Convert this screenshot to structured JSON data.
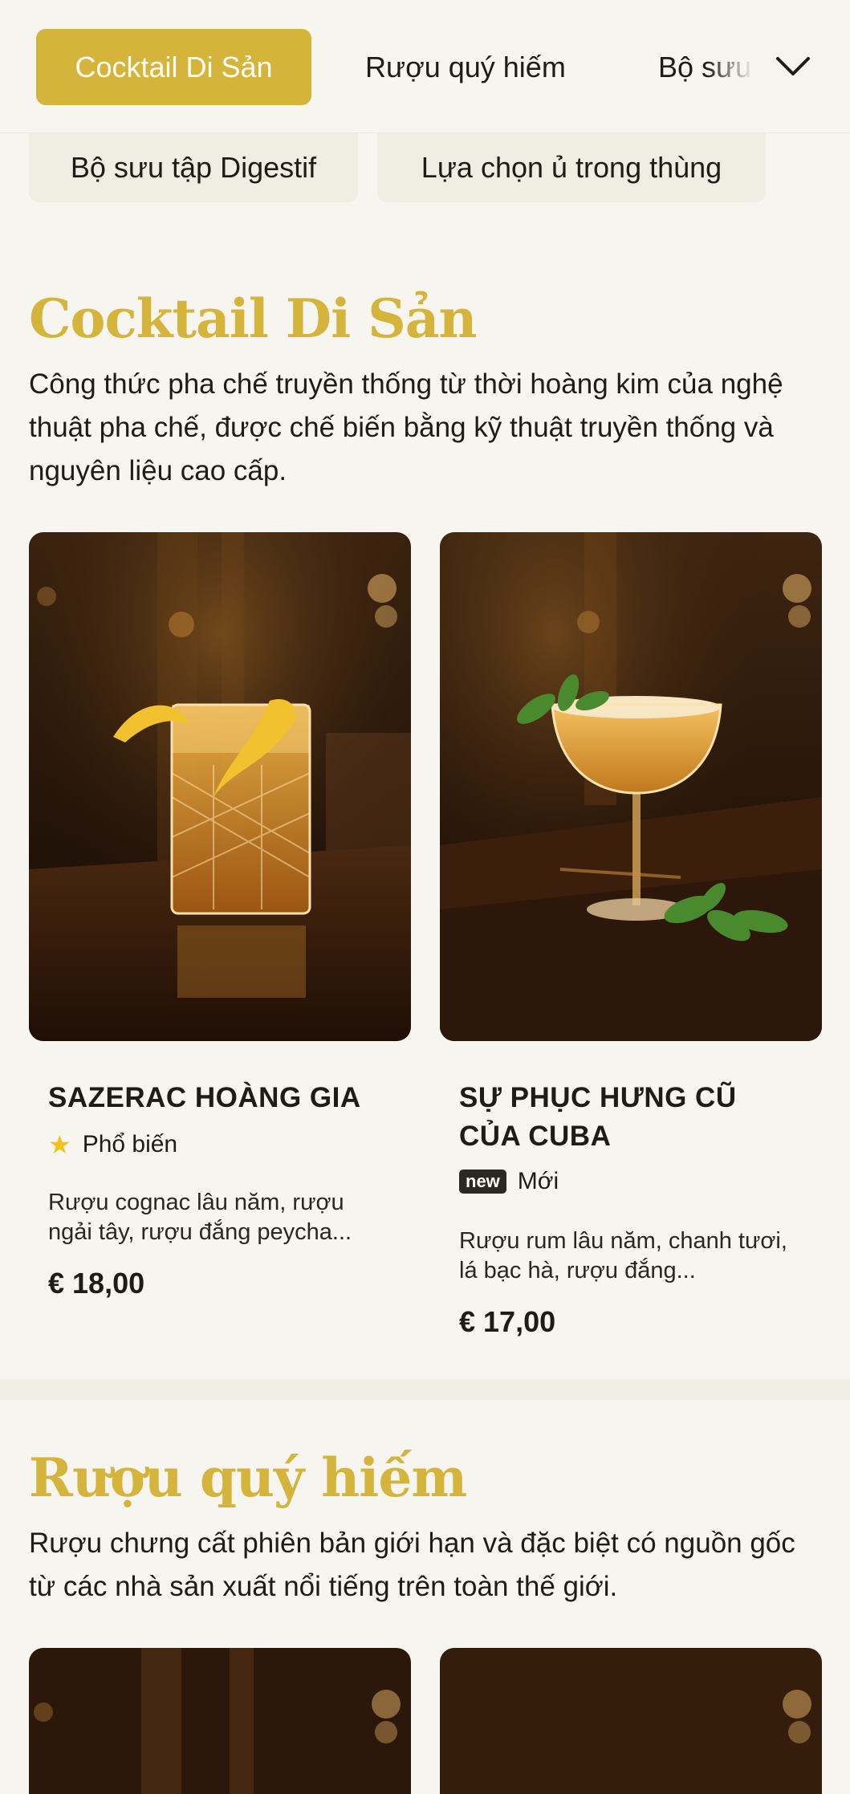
{
  "nav": {
    "tabs": [
      "Cocktail Di Sản",
      "Rượu quý hiếm",
      "Bộ sưu"
    ],
    "active_index": 0,
    "more_icon": "chevron-down-icon"
  },
  "chips": [
    "Bộ sưu tập Digestif",
    "Lựa chọn ủ trong thùng"
  ],
  "sections": [
    {
      "title": "Cocktail Di Sản",
      "description": "Công thức pha chế truyền thống từ thời hoàng kim của nghệ thuật pha chế, được chế biến bằng kỹ thuật truyền thống và nguyên liệu cao cấp.",
      "items": [
        {
          "name": "SAZERAC HOÀNG GIA",
          "badge_icon": "star-icon",
          "badge_label": "Phổ biến",
          "description": "Rượu cognac lâu năm, rượu ngải tây, rượu đắng peycha...",
          "price": "€ 18,00"
        },
        {
          "name": "SỰ PHỤC HƯNG CŨ CỦA CUBA",
          "badge_tag": "new",
          "badge_label": "Mới",
          "description": "Rượu rum lâu năm, chanh tươi, lá bạc hà, rượu đắng...",
          "price": "€ 17,00"
        }
      ]
    },
    {
      "title": "Rượu quý hiếm",
      "description": "Rượu chưng cất phiên bản giới hạn và đặc biệt có nguồn gốc từ các nhà sản xuất nổi tiếng trên toàn thế giới."
    }
  ],
  "colors": {
    "accent": "#d5b43c",
    "background": "#f7f5f0",
    "text": "#1f1c17"
  }
}
